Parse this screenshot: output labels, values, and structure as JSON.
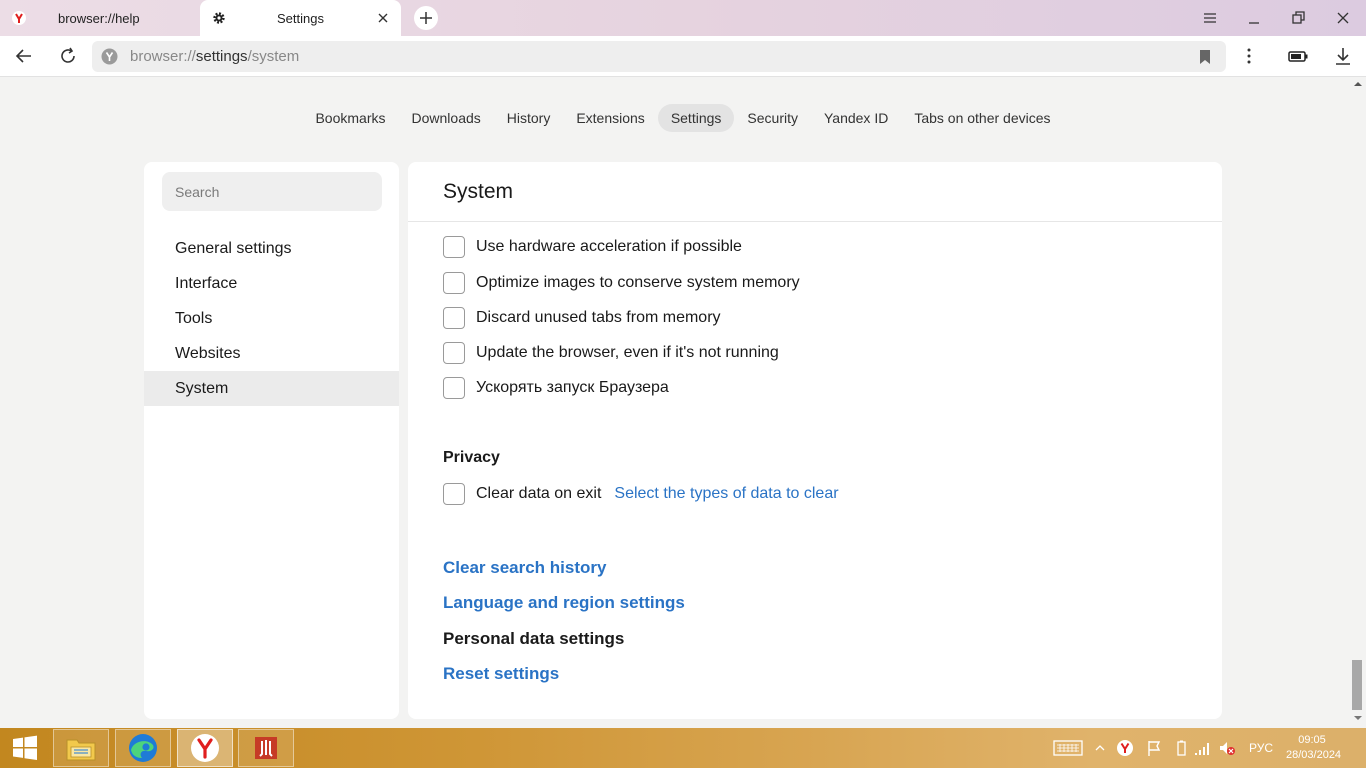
{
  "tabs": [
    {
      "title": "browser://help"
    },
    {
      "title": "Settings"
    }
  ],
  "address": {
    "prefix": "browser://",
    "middle": "settings",
    "suffix": "/system"
  },
  "topnav": [
    "Bookmarks",
    "Downloads",
    "History",
    "Extensions",
    "Settings",
    "Security",
    "Yandex ID",
    "Tabs on other devices"
  ],
  "topnav_active": "Settings",
  "sidebar": {
    "search_placeholder": "Search",
    "items": [
      "General settings",
      "Interface",
      "Tools",
      "Websites",
      "System"
    ],
    "active": "System"
  },
  "main": {
    "title": "System",
    "options": [
      {
        "label": "Use hardware acceleration if possible",
        "checked": false
      },
      {
        "label": "Optimize images to conserve system memory",
        "checked": false
      },
      {
        "label": "Discard unused tabs from memory",
        "checked": false
      },
      {
        "label": "Update the browser, even if it's not running",
        "checked": false
      },
      {
        "label": "Ускорять запуск Браузера",
        "checked": false
      }
    ],
    "privacy": {
      "title": "Privacy",
      "clear_on_exit_label": "Clear data on exit",
      "clear_on_exit_checked": false,
      "select_types_link": "Select the types of data to clear"
    },
    "links": {
      "clear_search_history": "Clear search history",
      "language_region": "Language and region settings",
      "personal_data": "Personal data settings",
      "reset": "Reset settings"
    }
  },
  "taskbar": {
    "language": "РУС",
    "time": "09:05",
    "date": "28/03/2024"
  },
  "colors": {
    "link": "#2a73c5",
    "yandex_red": "#e01f1f",
    "taskbar": "#cf9636"
  }
}
